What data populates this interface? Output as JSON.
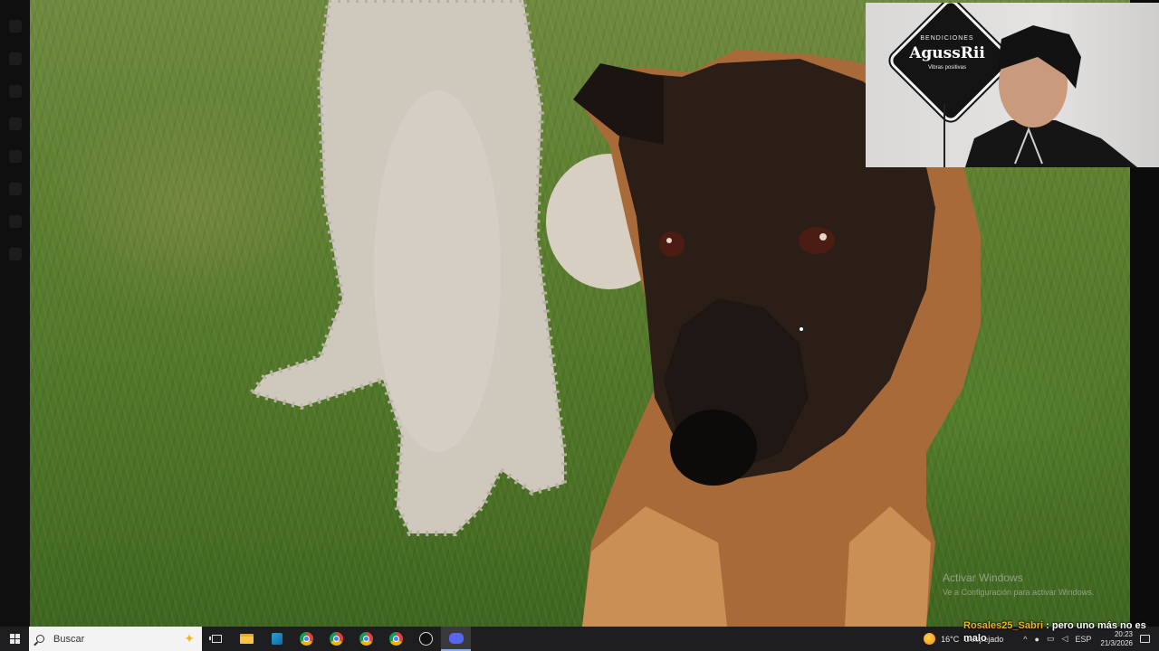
{
  "webcam": {
    "badge_top": "BENDICIONES",
    "badge_name": "AgussRii",
    "badge_sub": "Vibras positivas"
  },
  "watermark": {
    "title": "Activar Windows",
    "subtitle": "Ve a Configuración para activar Windows."
  },
  "chat": {
    "username": "Rosales25_Sabri",
    "separator": " : ",
    "message": "pero uno más no es malo"
  },
  "taskbar": {
    "search_placeholder": "Buscar",
    "icons": [
      "windows-start-icon",
      "task-view-icon",
      "file-explorer-icon",
      "app-icon",
      "chrome-icon",
      "chrome-icon",
      "chrome-icon",
      "chrome-icon",
      "obs-icon",
      "discord-icon"
    ],
    "temperature": "16°C",
    "weather": "Despejado",
    "language": "ESP",
    "time": "20:23",
    "date": "21/3/2026"
  },
  "colors": {
    "taskbar_bg": "#1e1e20",
    "chat_username": "#f0b429",
    "active_tab_underline": "#7ab3f2"
  }
}
